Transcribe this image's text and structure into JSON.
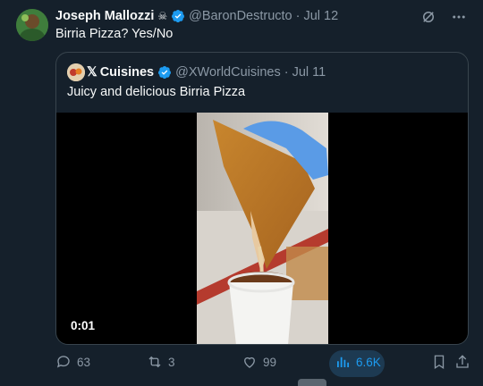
{
  "tweet": {
    "author_name": "Joseph Mallozzi",
    "author_emoji": "☠",
    "handle": "@BaronDestructo",
    "separator": "·",
    "date": "Jul 12",
    "text": "Birria Pizza?  Yes/No"
  },
  "quote": {
    "author_name": "Cuisines",
    "x_mark": "𝕏",
    "handle": "@XWorldCuisines",
    "separator": "·",
    "date": "Jul 11",
    "text": "Juicy and delicious Birria Pizza",
    "video_timestamp": "0:01"
  },
  "actions": {
    "replies": "63",
    "retweets": "3",
    "likes": "99",
    "views": "6.6K"
  },
  "colors": {
    "background": "#15202b",
    "accent": "#1d9bf0",
    "muted": "#8b98a5",
    "border": "#38444d"
  },
  "icons": [
    "grok-icon",
    "more-icon",
    "verified-icon",
    "reply-icon",
    "retweet-icon",
    "like-icon",
    "views-icon",
    "bookmark-icon",
    "share-icon"
  ]
}
